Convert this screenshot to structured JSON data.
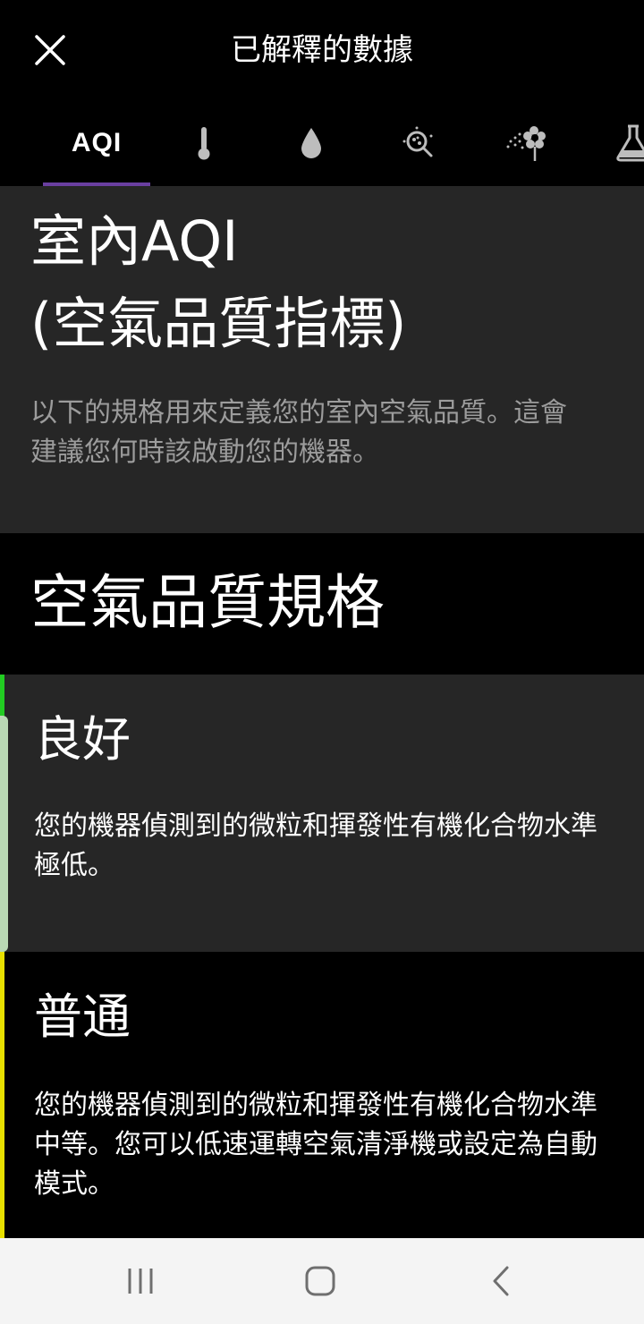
{
  "header": {
    "title": "已解釋的數據",
    "close_icon": "close-icon"
  },
  "tabs": [
    {
      "label": "AQI",
      "selected": true
    },
    {
      "icon": "thermometer-icon"
    },
    {
      "icon": "humidity-drop-icon"
    },
    {
      "icon": "particle-icon"
    },
    {
      "icon": "pollen-icon"
    },
    {
      "icon": "flask-icon"
    }
  ],
  "colors": {
    "tab_indicator": "#6a3fa0",
    "good": "#22cc22",
    "moderate": "#e8e000",
    "card_bg": "#262626"
  },
  "intro": {
    "title": "室內AQI\n(空氣品質指標)",
    "description": "以下的規格用來定義您的室內空氣品質。這會建議您何時該啟動您的機器。"
  },
  "spec": {
    "heading": "空氣品質規格",
    "levels": [
      {
        "name": "良好",
        "description": "您的機器偵測到的微粒和揮發性有機化合物水準極低。"
      },
      {
        "name": "普通",
        "description": "您的機器偵測到的微粒和揮發性有機化合物水準中等。您可以低速運轉空氣清淨機或設定為自動模式。"
      }
    ]
  },
  "navbar": {
    "recents_icon": "recents-icon",
    "home_icon": "home-icon",
    "back_icon": "back-icon"
  }
}
